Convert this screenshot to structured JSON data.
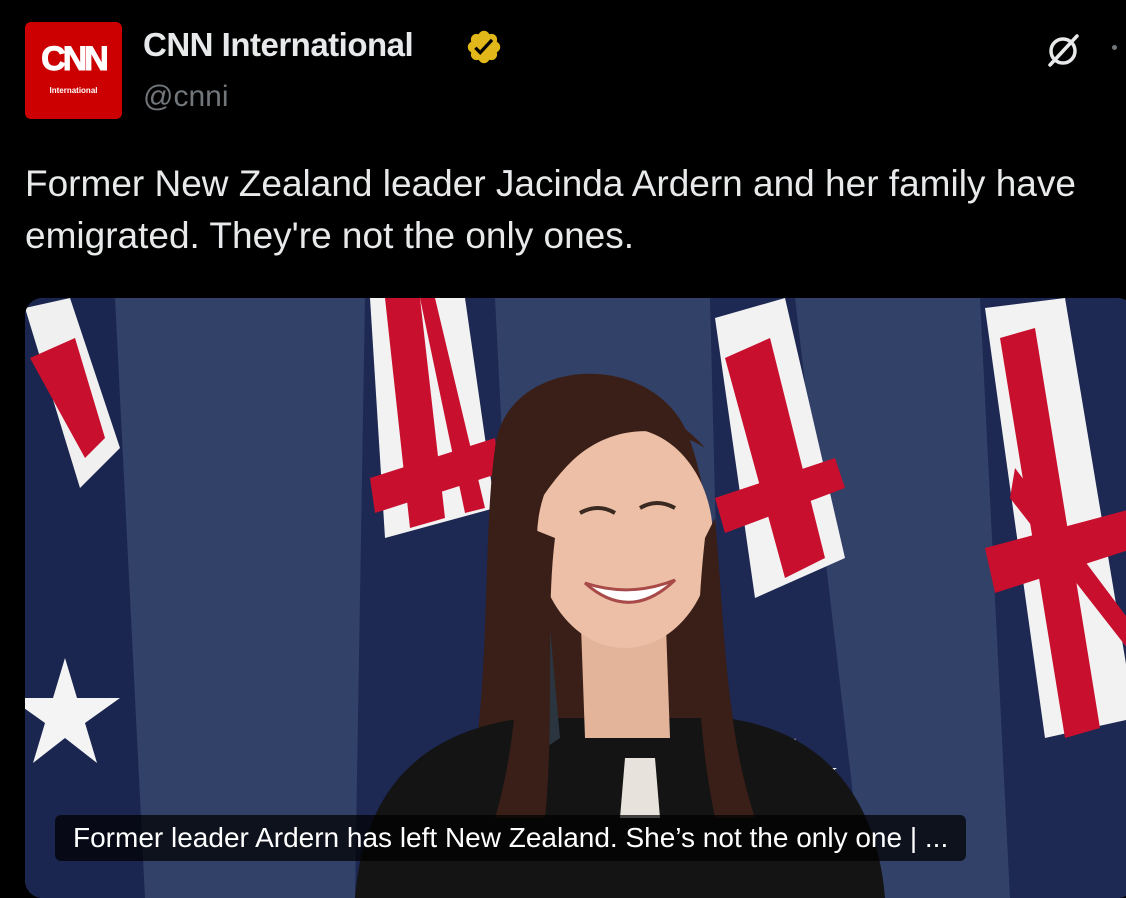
{
  "account": {
    "name": "CNN International",
    "handle": "@cnni",
    "avatar_text": "CNN",
    "avatar_subtext": "International",
    "verified_color": "#e2b719",
    "brand_color": "#cc0000"
  },
  "tweet": {
    "text": "Former New Zealand leader Jacinda Ardern and her family have emigrated. They're not the only ones."
  },
  "card": {
    "title": "Former leader Ardern has left New Zealand. She’s not the only one | ..."
  },
  "icons": {
    "verified": "verified-badge-icon",
    "grok": "grok-icon",
    "more": "more-icon"
  }
}
